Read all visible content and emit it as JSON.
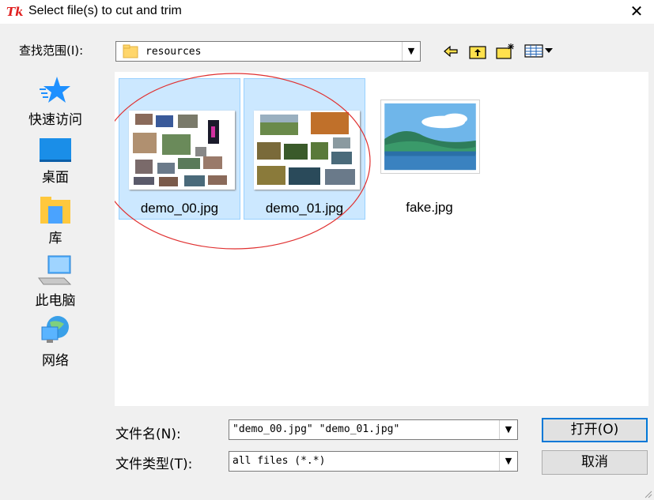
{
  "window": {
    "title": "Select file(s) to cut and trim",
    "app_icon_text": "Tk",
    "close_label": "✕"
  },
  "toolbar": {
    "look_in_label": "查找范围(I):",
    "look_in_value": "resources",
    "back_icon": "back-arrow-icon",
    "up_icon": "up-folder-icon",
    "new_folder_icon": "new-folder-icon",
    "view_menu_icon": "view-menu-icon"
  },
  "places": [
    {
      "label": "快速访问",
      "icon": "star-icon"
    },
    {
      "label": "桌面",
      "icon": "desktop-icon"
    },
    {
      "label": "库",
      "icon": "library-icon"
    },
    {
      "label": "此电脑",
      "icon": "computer-icon"
    },
    {
      "label": "网络",
      "icon": "network-icon"
    }
  ],
  "files": [
    {
      "name": "demo_00.jpg",
      "selected": true
    },
    {
      "name": "demo_01.jpg",
      "selected": true
    },
    {
      "name": "fake.jpg",
      "selected": false
    }
  ],
  "bottom": {
    "filename_label": "文件名(N):",
    "filename_value": "\"demo_00.jpg\" \"demo_01.jpg\"",
    "filetype_label": "文件类型(T):",
    "filetype_value": "all files (*.*)",
    "open_button": "打开(O)",
    "cancel_button": "取消"
  },
  "colors": {
    "selection_fill": "#cce8ff",
    "selection_border": "#99d1ff",
    "annotation_ellipse": "#e03030",
    "accent": "#0078d7"
  }
}
